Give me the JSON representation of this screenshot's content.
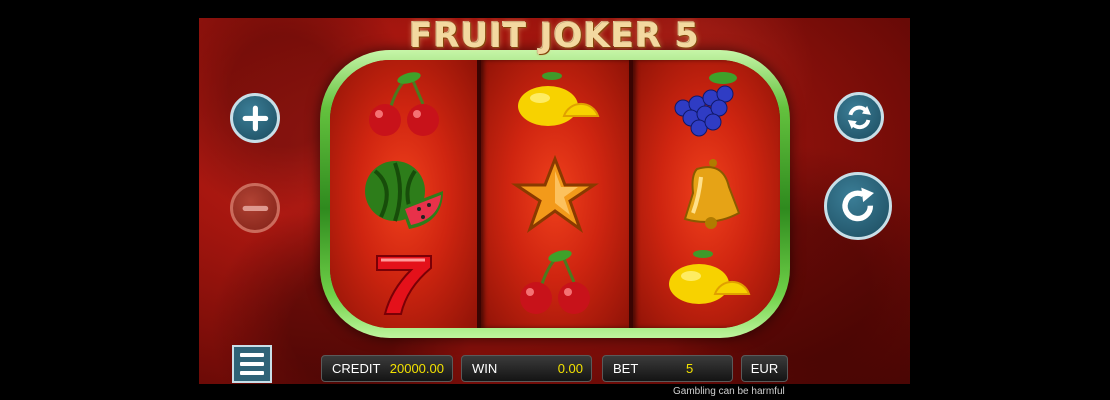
{
  "game": {
    "title": "FRUIT JOKER 5"
  },
  "reels": [
    [
      "cherries",
      "watermelon",
      "seven"
    ],
    [
      "lemon",
      "star",
      "cherries"
    ],
    [
      "grapes",
      "bell",
      "lemon"
    ]
  ],
  "controls": {
    "plus_icon": "plus-icon",
    "minus_icon": "minus-icon",
    "autoplay_icon": "autoplay-icon",
    "spin_icon": "spin-icon",
    "menu_icon": "menu-icon"
  },
  "bottom_bar": {
    "credit_label": "CREDIT",
    "credit_value": "20000.00",
    "win_label": "WIN",
    "win_value": "0.00",
    "bet_label": "BET",
    "bet_value": "5",
    "currency": "EUR"
  },
  "disclaimer": "Gambling can be harmful",
  "colors": {
    "background": "#a5160f",
    "frame": "#2f8a1e",
    "button": "#1c4b5e",
    "value_text": "#f2e100"
  }
}
